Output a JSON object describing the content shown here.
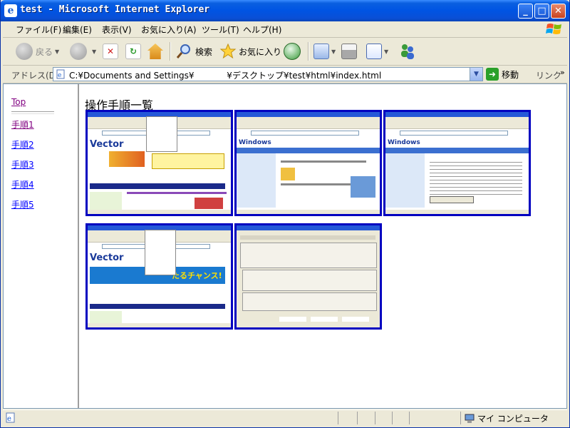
{
  "window": {
    "title": "test - Microsoft Internet Explorer",
    "app_icon_letter": "e",
    "minimize": "_",
    "maximize": "□",
    "close": "✕"
  },
  "menu": [
    "ファイル(F)",
    "編集(E)",
    "表示(V)",
    "お気に入り(A)",
    "ツール(T)",
    "ヘルプ(H)"
  ],
  "toolbar": {
    "back": "戻る",
    "search": "検索",
    "favorites": "お気に入り"
  },
  "address": {
    "label": "アドレス(D)",
    "url": "C:¥Documents and Settings¥            ¥デスクトップ¥test¥html¥index.html",
    "go": "移動",
    "links": "リンク"
  },
  "nav": {
    "top": "Top",
    "items": [
      "手順1",
      "手順2",
      "手順3",
      "手順4",
      "手順5"
    ]
  },
  "main": {
    "title": "操作手順一覧"
  },
  "thumbnails": [
    {
      "id": "1",
      "logo": "Vector",
      "banner": "",
      "accent": "#e8a000"
    },
    {
      "id": "2",
      "logo": "Windows",
      "banner": "",
      "accent": "#3b6fd0"
    },
    {
      "id": "3",
      "logo": "Windows",
      "banner": "",
      "accent": "#3b6fd0"
    },
    {
      "id": "4",
      "logo": "Vector",
      "banner": "たるチャンス!",
      "accent": "#e8a000"
    },
    {
      "id": "5",
      "logo": "",
      "banner": "",
      "accent": "#ece9d8"
    }
  ],
  "status": {
    "zone": "マイ コンピュータ"
  },
  "colors": {
    "titlebar": "#0054e3",
    "link": "#0000ff",
    "visited": "#800080",
    "thumb_border": "#0000c0"
  }
}
